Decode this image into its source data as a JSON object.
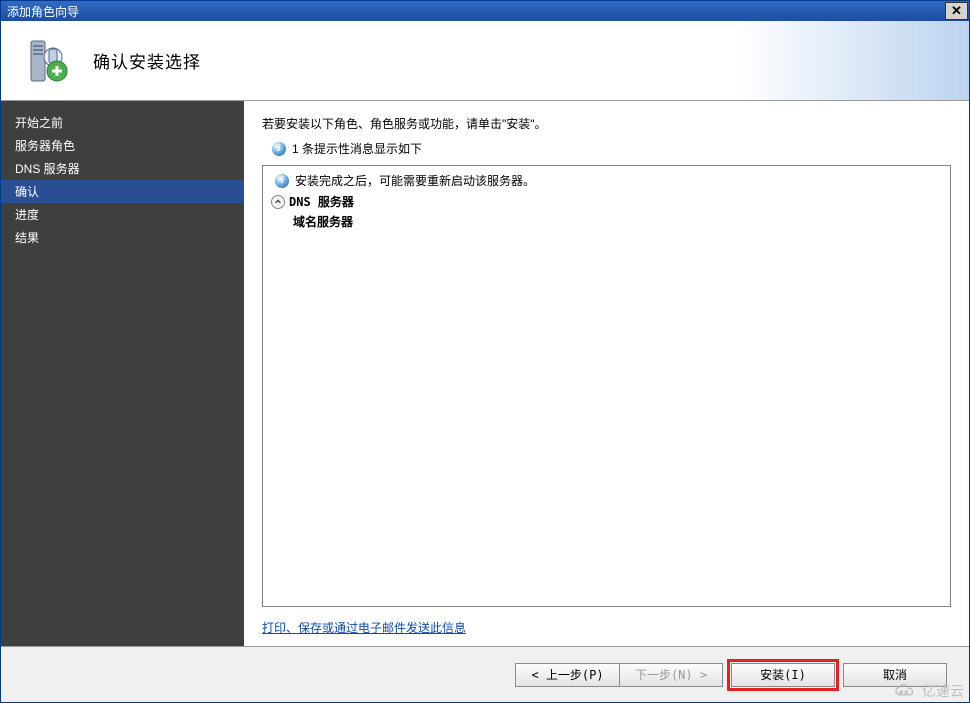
{
  "titlebar": {
    "title": "添加角色向导"
  },
  "header": {
    "title": "确认安装选择"
  },
  "sidebar": {
    "items": [
      {
        "label": "开始之前"
      },
      {
        "label": "服务器角色"
      },
      {
        "label": "DNS 服务器"
      },
      {
        "label": "确认",
        "selected": true
      },
      {
        "label": "进度"
      },
      {
        "label": "结果"
      }
    ]
  },
  "main": {
    "intro": "若要安装以下角色、角色服务或功能，请单击\"安装\"。",
    "info_count": "1 条提示性消息显示如下",
    "warning": "安装完成之后，可能需要重新启动该服务器。",
    "role_title": "DNS 服务器",
    "role_sub": "域名服务器",
    "print_link": "打印、保存或通过电子邮件发送此信息"
  },
  "footer": {
    "prev": "< 上一步(P)",
    "next": "下一步(N) >",
    "install": "安装(I)",
    "cancel": "取消"
  },
  "watermark": "亿速云"
}
